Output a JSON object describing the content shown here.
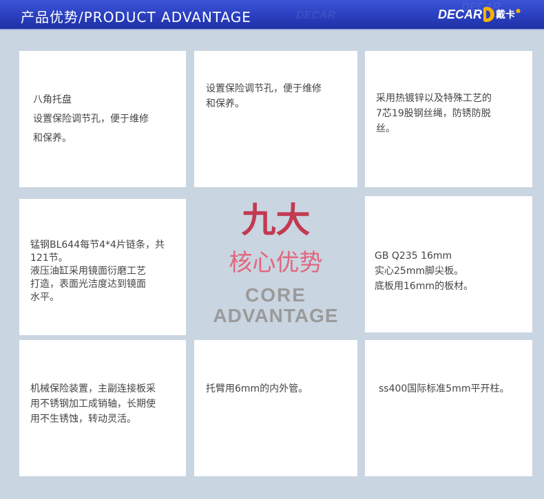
{
  "header": {
    "title": "产品优势/PRODUCT  ADVANTAGE",
    "logo_text": "DECAR",
    "logo_cn": "戴卡",
    "watermark": "DECAR"
  },
  "cards": [
    {
      "lines": [
        "八角托盘",
        "设置保险调节孔，便于维修",
        "和保养。"
      ]
    },
    {
      "lines": [
        "设置保险调节孔，便于维修",
        "和保养。"
      ]
    },
    {
      "lines": [
        "采用热镀锌以及特殊工艺的",
        "7芯19股钢丝绳，防锈防脱",
        "丝。"
      ]
    },
    {
      "lines": [
        "锰钢BL644每节4*4片链条，共",
        "121节。",
        "液压油缸采用镜面衍磨工艺",
        "打造，表面光洁度达到镜面",
        "水平。"
      ]
    },
    {
      "lines": [
        "GB  Q235  16mm",
        "实心25mm脚尖板。",
        "底板用16mm的板材。"
      ]
    },
    {
      "lines": [
        "机械保险装置，主副连接板采",
        "用不锈钢加工成销轴，长期使",
        "用不生锈蚀，转动灵活。"
      ]
    },
    {
      "lines": [
        "托臂用6mm的内外管。"
      ]
    },
    {
      "lines": [
        "ss400国际标准5mm平开柱。"
      ]
    }
  ],
  "center": {
    "cn_big": "九大",
    "cn_sub": "核心优势",
    "en_1": "CORE",
    "en_2": "ADVANTAGE"
  },
  "colors": {
    "header_blue": "#2a3fbf",
    "page_bg": "#c9d5e1",
    "accent_red": "#c23a52",
    "accent_pink": "#e2667d",
    "logo_gold": "#f5b400"
  }
}
